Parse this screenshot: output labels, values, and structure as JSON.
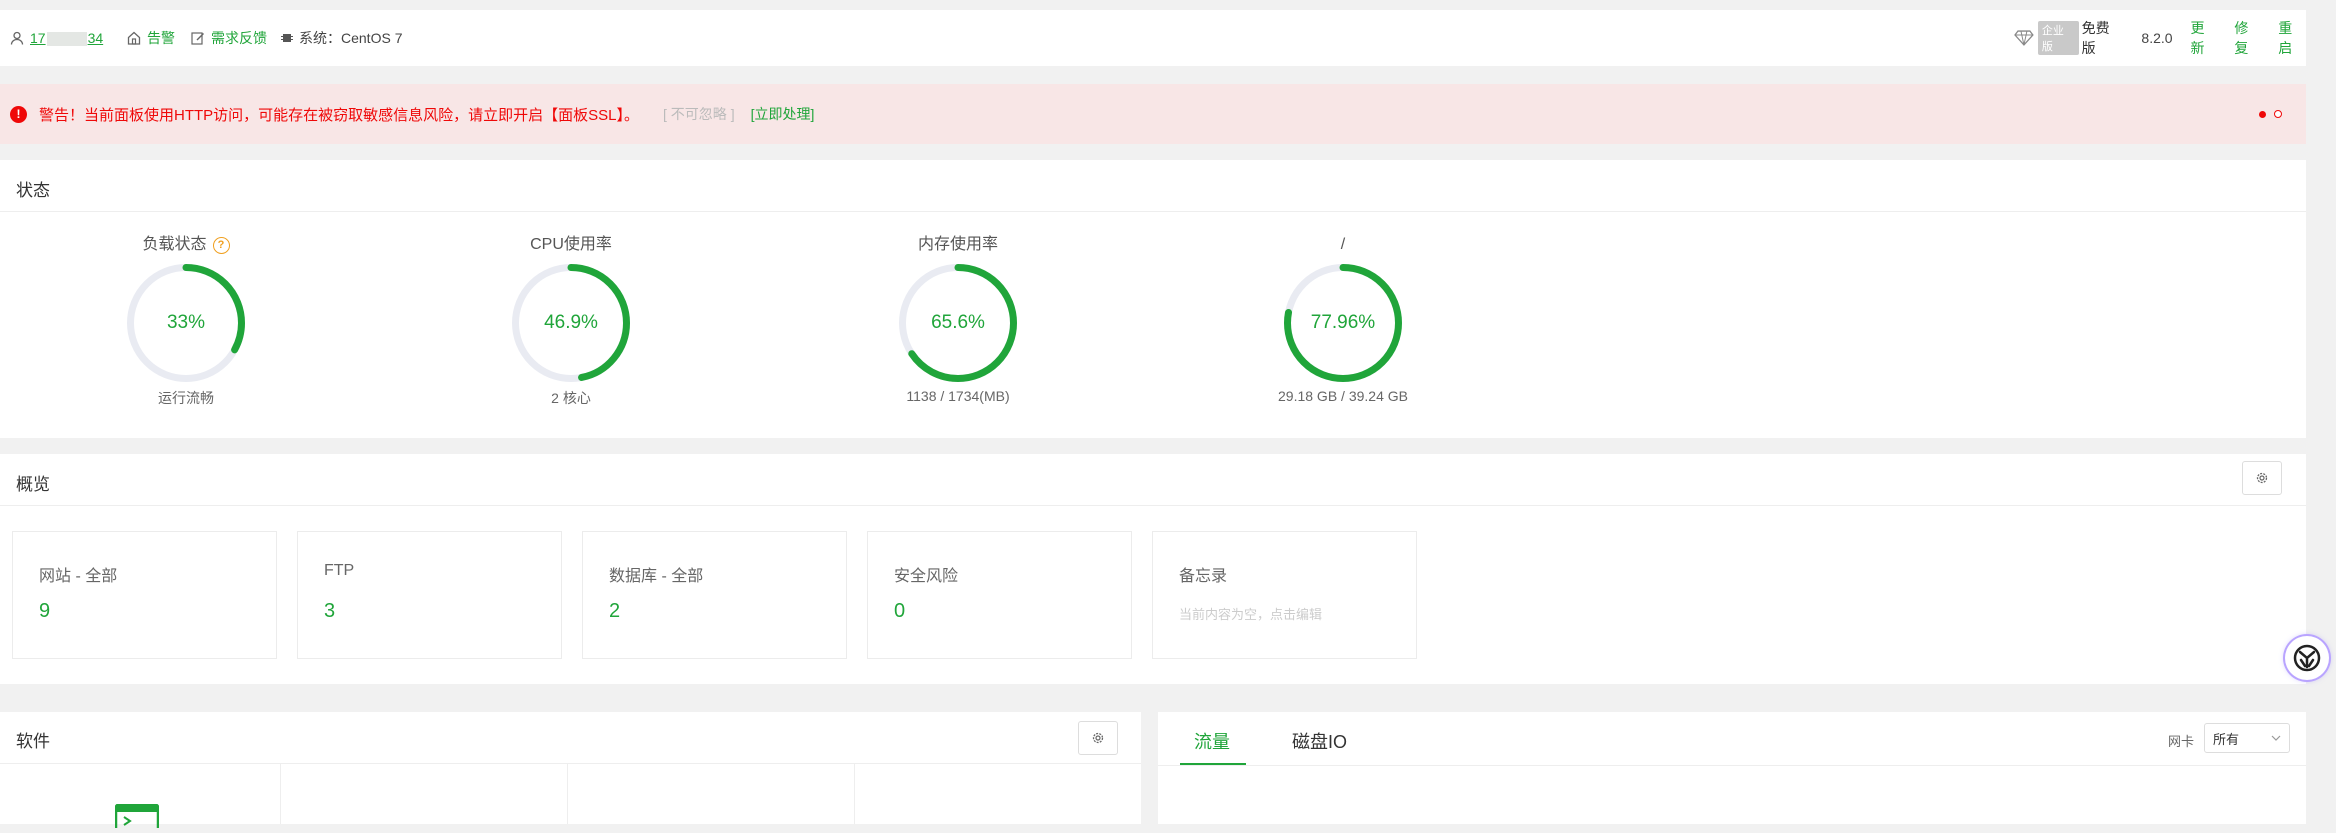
{
  "topbar": {
    "user_prefix": "17",
    "user_suffix": "34",
    "alarm_label": "告警",
    "feedback_label": "需求反馈",
    "system_label": "系统：CentOS 7",
    "edition_badge": "企业版",
    "edition_label": "免费版",
    "version": "8.2.0",
    "update_label": "更新",
    "repair_label": "修复",
    "restart_label": "重启"
  },
  "alert": {
    "icon": "!",
    "message": "警告！当前面板使用HTTP访问，可能存在被窃取敏感信息风险，请立即开启【面板SSL】。",
    "ignore_label": "[ 不可忽略 ]",
    "action_label": "[立即处理]"
  },
  "status": {
    "title": "状态",
    "gauges": [
      {
        "label": "负载状态",
        "value": "33%",
        "sub": "运行流畅",
        "percent": 33,
        "help_icon": "?"
      },
      {
        "label": "CPU使用率",
        "value": "46.9%",
        "sub": "2 核心",
        "percent": 46.9
      },
      {
        "label": "内存使用率",
        "value": "65.6%",
        "sub": "1138 / 1734(MB)",
        "percent": 65.6
      },
      {
        "label": "/",
        "value": "77.96%",
        "sub": "29.18 GB / 39.24 GB",
        "percent": 77.96
      }
    ]
  },
  "overview": {
    "title": "概览",
    "cards": [
      {
        "label": "网站 - 全部",
        "value": "9"
      },
      {
        "label": "FTP",
        "value": "3"
      },
      {
        "label": "数据库 - 全部",
        "value": "2"
      },
      {
        "label": "安全风险",
        "value": "0"
      },
      {
        "label": "备忘录",
        "placeholder": "当前内容为空，点击编辑"
      }
    ]
  },
  "software": {
    "title": "软件"
  },
  "traffic": {
    "tabs": [
      "流量",
      "磁盘IO"
    ],
    "nic_label": "网卡",
    "nic_selected": "所有"
  },
  "colors": {
    "accent": "#20a53a",
    "warning": "#ef0808",
    "track": "#e9ebf2"
  }
}
